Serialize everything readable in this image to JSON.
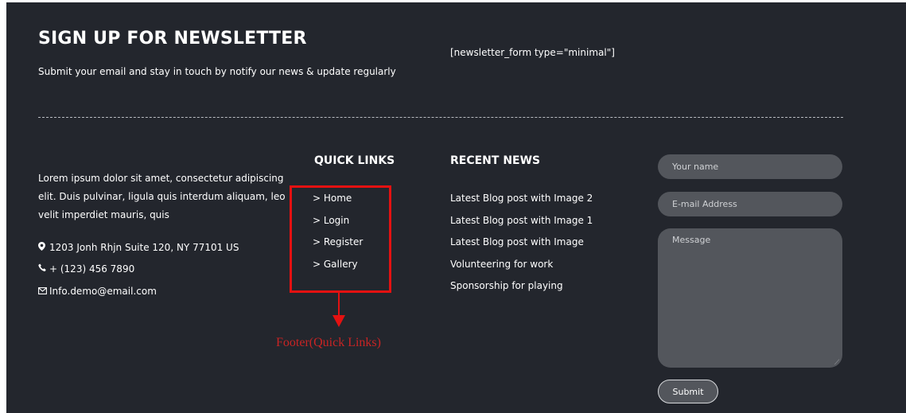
{
  "newsletter": {
    "title": "SIGN UP FOR NEWSLETTER",
    "subtitle": "Submit your email and stay in touch by notify our news & update regularly",
    "shortcode": "[newsletter_form type=\"minimal\"]"
  },
  "about": {
    "text": "Lorem ipsum dolor sit amet, consectetur adipiscing elit. Duis pulvinar, ligula quis interdum aliquam, leo velit imperdiet mauris, quis",
    "address": "1203 Jonh Rhjn Suite 120, NY 77101 US",
    "phone": "+ (123) 456 7890",
    "email": "Info.demo@email.com",
    "icons": {
      "address": "map-marker-icon",
      "phone": "phone-icon",
      "email": "envelope-icon"
    }
  },
  "quick_links": {
    "title": "QUICK LINKS",
    "items": [
      "> Home",
      "> Login",
      "> Register",
      "> Gallery"
    ]
  },
  "recent_news": {
    "title": "RECENT NEWS",
    "items": [
      "Latest Blog post with Image 2",
      "Latest Blog post with Image 1",
      "Latest Blog post with Image",
      "Volunteering for work",
      "Sponsorship for playing"
    ]
  },
  "contact_form": {
    "name_placeholder": "Your name",
    "email_placeholder": "E-mail Address",
    "message_placeholder": "Message",
    "submit_label": "Submit"
  },
  "annotation": {
    "label": "Footer(Quick Links)",
    "color": "#e41111"
  },
  "colors": {
    "background": "#23262d",
    "field": "#53565c",
    "text": "#ffffff"
  }
}
